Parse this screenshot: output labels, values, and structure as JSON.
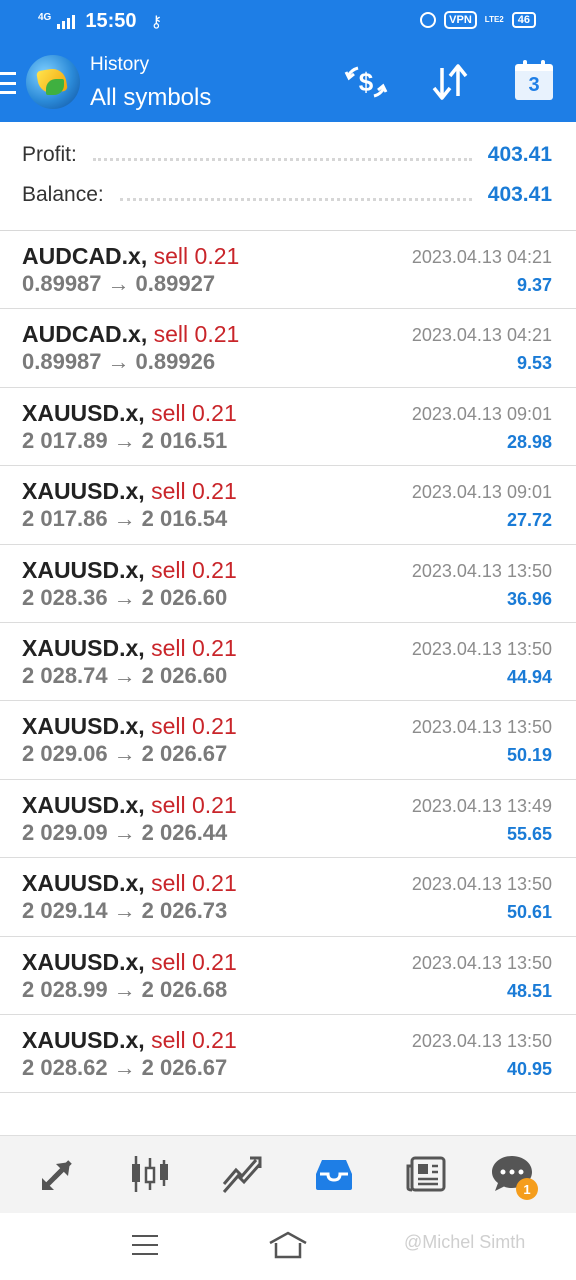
{
  "status_bar": {
    "network": "4G",
    "time": "15:50",
    "vpn": "VPN",
    "lte": "LTE2",
    "battery": "46"
  },
  "header": {
    "subtitle": "History",
    "title": "All symbols",
    "calendar_day": "3"
  },
  "summary": {
    "profit_label": "Profit:",
    "profit_value": "403.41",
    "balance_label": "Balance:",
    "balance_value": "403.41"
  },
  "trades": [
    {
      "symbol": "AUDCAD.x,",
      "type": "sell 0.21",
      "open": "0.89987",
      "close": "0.89927",
      "time": "2023.04.13 04:21",
      "profit": "9.37"
    },
    {
      "symbol": "AUDCAD.x,",
      "type": "sell 0.21",
      "open": "0.89987",
      "close": "0.89926",
      "time": "2023.04.13 04:21",
      "profit": "9.53"
    },
    {
      "symbol": "XAUUSD.x,",
      "type": "sell 0.21",
      "open": "2 017.89",
      "close": "2 016.51",
      "time": "2023.04.13 09:01",
      "profit": "28.98"
    },
    {
      "symbol": "XAUUSD.x,",
      "type": "sell 0.21",
      "open": "2 017.86",
      "close": "2 016.54",
      "time": "2023.04.13 09:01",
      "profit": "27.72"
    },
    {
      "symbol": "XAUUSD.x,",
      "type": "sell 0.21",
      "open": "2 028.36",
      "close": "2 026.60",
      "time": "2023.04.13 13:50",
      "profit": "36.96"
    },
    {
      "symbol": "XAUUSD.x,",
      "type": "sell 0.21",
      "open": "2 028.74",
      "close": "2 026.60",
      "time": "2023.04.13 13:50",
      "profit": "44.94"
    },
    {
      "symbol": "XAUUSD.x,",
      "type": "sell 0.21",
      "open": "2 029.06",
      "close": "2 026.67",
      "time": "2023.04.13 13:50",
      "profit": "50.19"
    },
    {
      "symbol": "XAUUSD.x,",
      "type": "sell 0.21",
      "open": "2 029.09",
      "close": "2 026.44",
      "time": "2023.04.13 13:49",
      "profit": "55.65"
    },
    {
      "symbol": "XAUUSD.x,",
      "type": "sell 0.21",
      "open": "2 029.14",
      "close": "2 026.73",
      "time": "2023.04.13 13:50",
      "profit": "50.61"
    },
    {
      "symbol": "XAUUSD.x,",
      "type": "sell 0.21",
      "open": "2 028.99",
      "close": "2 026.68",
      "time": "2023.04.13 13:50",
      "profit": "48.51"
    },
    {
      "symbol": "XAUUSD.x,",
      "type": "sell 0.21",
      "open": "2 028.62",
      "close": "2 026.67",
      "time": "2023.04.13 13:50",
      "profit": "40.95"
    }
  ],
  "bottom_nav": {
    "items": [
      {
        "icon": "quotes-icon"
      },
      {
        "icon": "chart-icon"
      },
      {
        "icon": "trade-icon"
      },
      {
        "icon": "history-icon",
        "active": true
      },
      {
        "icon": "news-icon"
      },
      {
        "icon": "messages-icon",
        "badge": "1"
      }
    ]
  },
  "watermark": "@Michel Simth",
  "colors": {
    "header": "#1e7ee6",
    "sell": "#c9252a",
    "profit": "#1a7bd6",
    "active_nav": "#1e7ee6",
    "badge": "#f59d1c"
  }
}
